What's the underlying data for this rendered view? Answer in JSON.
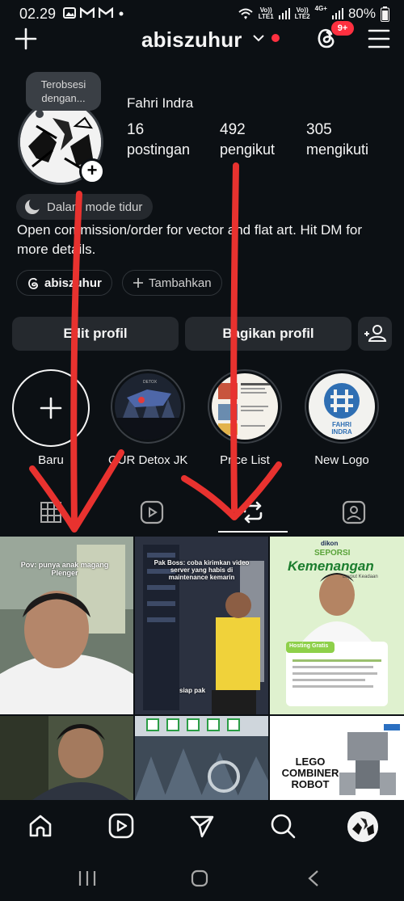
{
  "status_bar": {
    "time": "02.29",
    "notif_icons": [
      "image-icon",
      "gmail-icon",
      "gmail-icon",
      "dot-icon"
    ],
    "net1_top": "Vo))",
    "net1_bottom": "LTE1",
    "net2_top": "Vo))",
    "net2_bottom": "LTE2",
    "net2_type": "4G+",
    "battery": "80%"
  },
  "header": {
    "username": "abiszuhur",
    "threads_badge": "9+",
    "live_dot_color": "#ff3040"
  },
  "profile": {
    "note": "Terobsesi dengan...",
    "name": "Fahri Indra",
    "stats": [
      {
        "value": "16",
        "label": "postingan"
      },
      {
        "value": "492",
        "label": "pengikut"
      },
      {
        "value": "305",
        "label": "mengikuti"
      }
    ],
    "sleep_mode": "Dalam mode tidur",
    "bio": "Open commission/order for vector and flat art. Hit DM for more details.",
    "threads_link": "abiszuhur",
    "add_label": "Tambahkan"
  },
  "buttons": {
    "edit": "Edit profil",
    "share": "Bagikan profil"
  },
  "highlights": [
    {
      "label": "Baru",
      "icon": "plus-icon"
    },
    {
      "label": "OUR Detox JK...",
      "icon": "detox-cover"
    },
    {
      "label": "Price List",
      "icon": "pricelist-cover"
    },
    {
      "label": "New Logo",
      "icon": "newlogo-cover"
    }
  ],
  "highlight_texts": {
    "detox_mini": "DETOX",
    "logo_line1": "FAHRI",
    "logo_line2": "INDRA"
  },
  "tabs": [
    "grid-icon",
    "reels-icon",
    "reposts-icon",
    "tagged-icon"
  ],
  "active_tab": "reposts",
  "grid_texts": {
    "post1": "Pov: punya anak magang Plenger",
    "post2": "Pak Boss: coba kirimkan video server yang habis di maintenance kemarin",
    "post2_tag": "siap pak",
    "post3_brand": "dikon",
    "post3_heading": "SEPORSI",
    "post3_title": "Kemenangan",
    "post3_sub": "Layout Keadaan",
    "post3_box": "Hosting Gratis",
    "post6_line1": "LEGO",
    "post6_line2": "COMBINER",
    "post6_line3": "ROBOT"
  },
  "bottom_nav": [
    "home-icon",
    "reels-icon",
    "direct-icon",
    "search-icon",
    "profile-avatar"
  ],
  "colors": {
    "background": "#0c1014",
    "button": "#25292e",
    "arrow": "#e8322f",
    "accent_green": "#8ed04a"
  }
}
